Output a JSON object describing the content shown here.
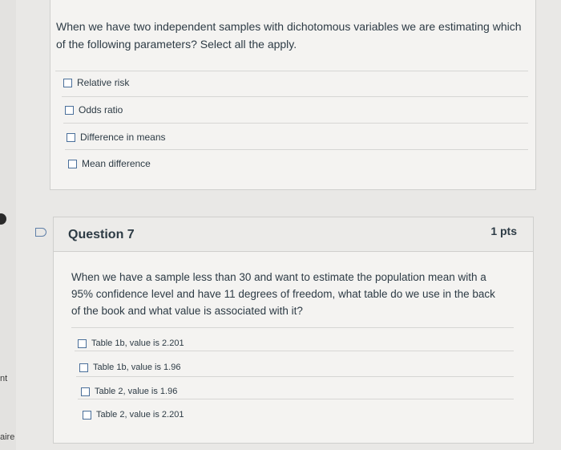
{
  "question6": {
    "text": "When we have two independent samples with dichotomous variables we are estimating which of the following parameters? Select all the apply.",
    "answers": [
      "Relative risk",
      "Odds ratio",
      "Difference in means",
      "Mean difference"
    ]
  },
  "question7": {
    "title": "Question 7",
    "points": "1 pts",
    "text": "When we have a sample less than 30 and want to estimate the population mean with a 95% confidence level and have 11 degrees of freedom, what table do we use in the back of the book and what value is associated with it?",
    "answers": [
      "Table 1b, value is 2.201",
      "Table 1b, value is 1.96",
      "Table 2, value is 1.96",
      "Table 2, value is 2.201"
    ]
  },
  "side": {
    "text1": "nt",
    "text2": "aire"
  }
}
